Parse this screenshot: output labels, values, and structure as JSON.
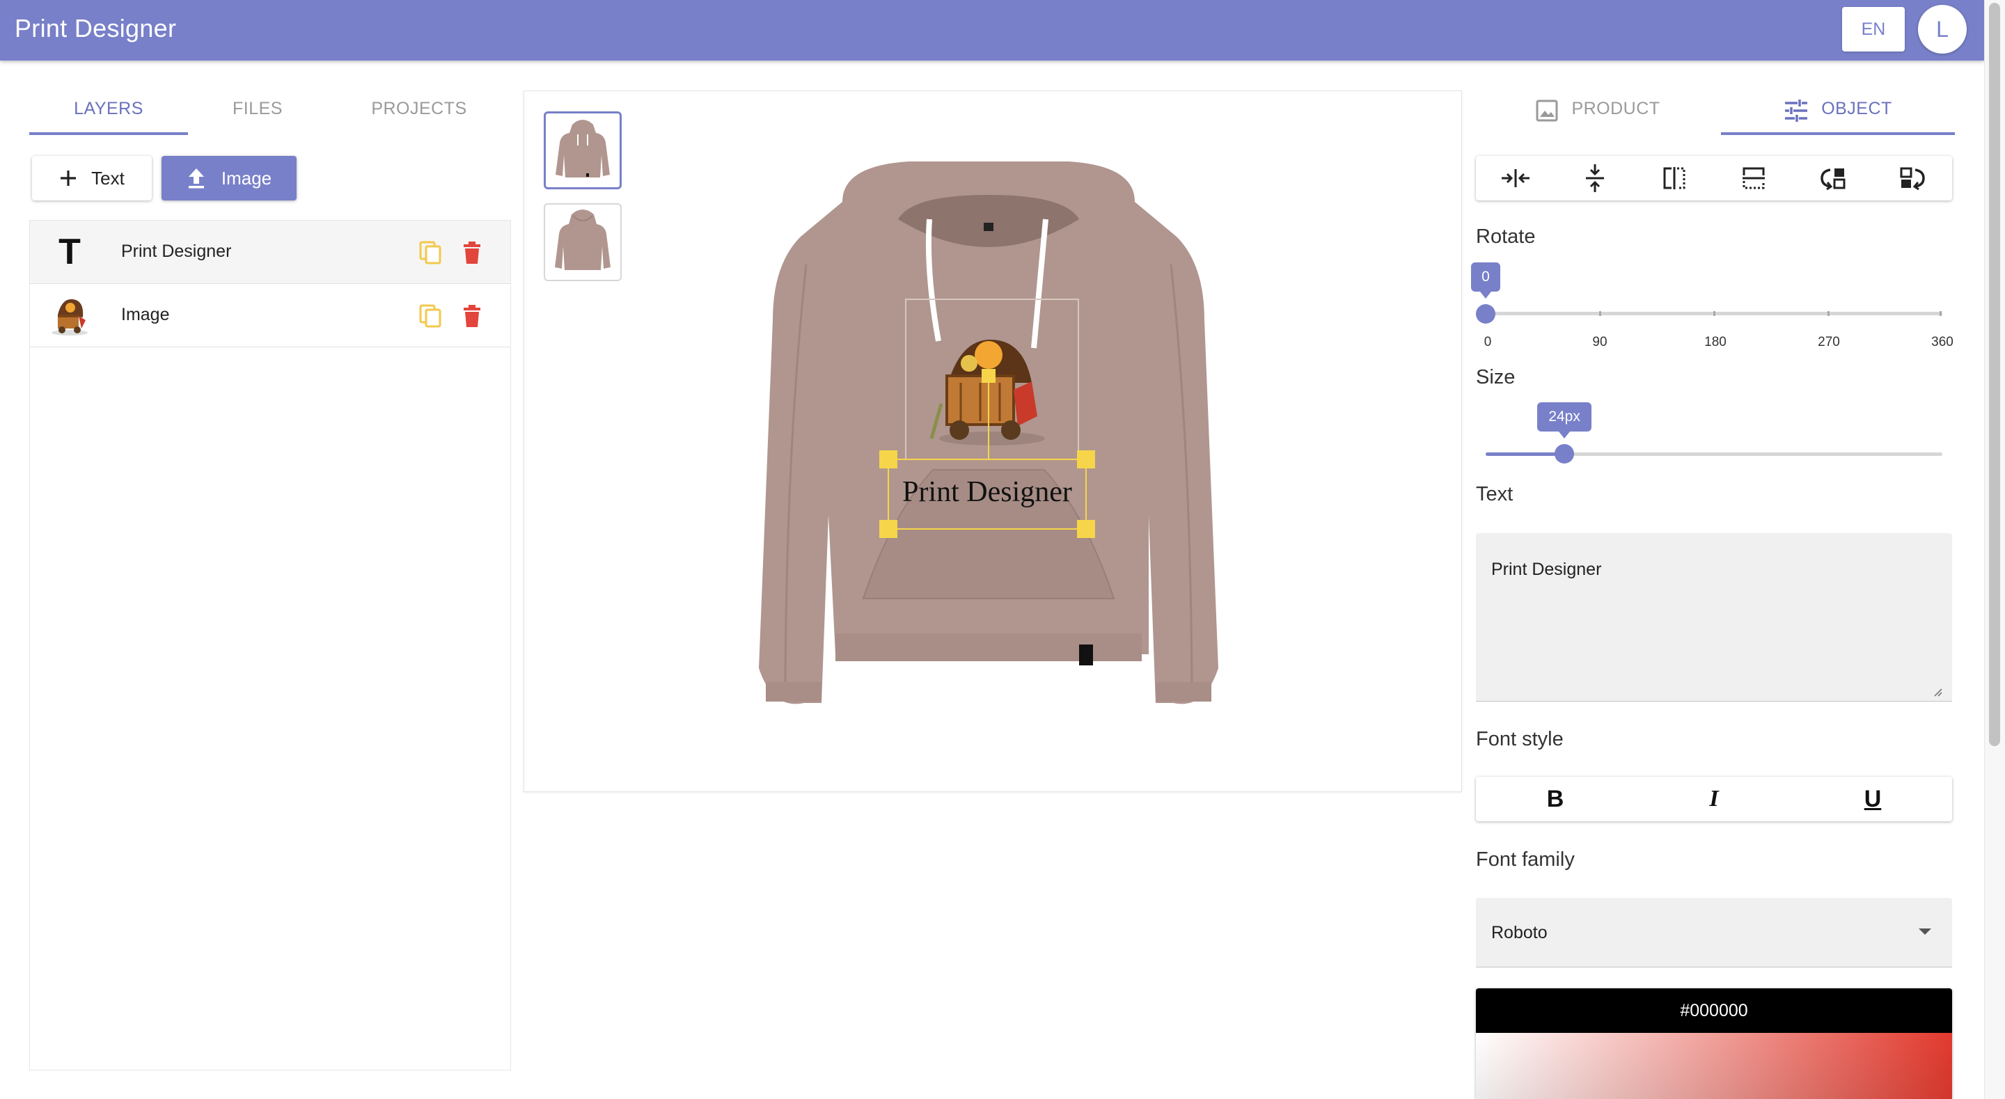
{
  "app": {
    "title": "Print Designer"
  },
  "header": {
    "language": "EN",
    "avatar_initial": "L"
  },
  "left_panel": {
    "tabs": [
      {
        "label": "LAYERS",
        "active": true
      },
      {
        "label": "FILES",
        "active": false
      },
      {
        "label": "PROJECTS",
        "active": false
      }
    ],
    "add_text_label": "Text",
    "add_image_label": "Image",
    "layers": [
      {
        "name": "Print Designer",
        "kind": "text",
        "thumb_glyph": "T",
        "selected": true
      },
      {
        "name": "Image",
        "kind": "image",
        "selected": false
      }
    ]
  },
  "canvas": {
    "views": [
      {
        "name": "front",
        "selected": true
      },
      {
        "name": "back",
        "selected": false
      }
    ],
    "product_color": "#b0968f",
    "design_text": "Print Designer",
    "handle_color": "#f6d54a"
  },
  "right_panel": {
    "tabs": [
      {
        "label": "PRODUCT",
        "icon": "image-icon",
        "active": false
      },
      {
        "label": "OBJECT",
        "icon": "tune-icon",
        "active": true
      }
    ],
    "toolbar": [
      "center-horizontal-icon",
      "center-vertical-icon",
      "flip-horizontal-icon",
      "flip-vertical-icon",
      "bring-forward-icon",
      "send-backward-icon"
    ],
    "rotate": {
      "label": "Rotate",
      "value": 0,
      "display": "0",
      "min": 0,
      "max": 360,
      "tick_labels": [
        "0",
        "90",
        "180",
        "270",
        "360"
      ]
    },
    "size": {
      "label": "Size",
      "value": 24,
      "display": "24px",
      "min": 4,
      "max": 120
    },
    "text": {
      "label": "Text",
      "value": "Print Designer"
    },
    "font_style": {
      "label": "Font style",
      "bold": "B",
      "italic": "I",
      "underline": "U"
    },
    "font_family": {
      "label": "Font family",
      "value": "Roboto"
    },
    "color": {
      "hex": "#000000"
    }
  },
  "colors": {
    "accent": "#7880c9",
    "delete": "#e2453c",
    "copy": "#f2c94c"
  }
}
